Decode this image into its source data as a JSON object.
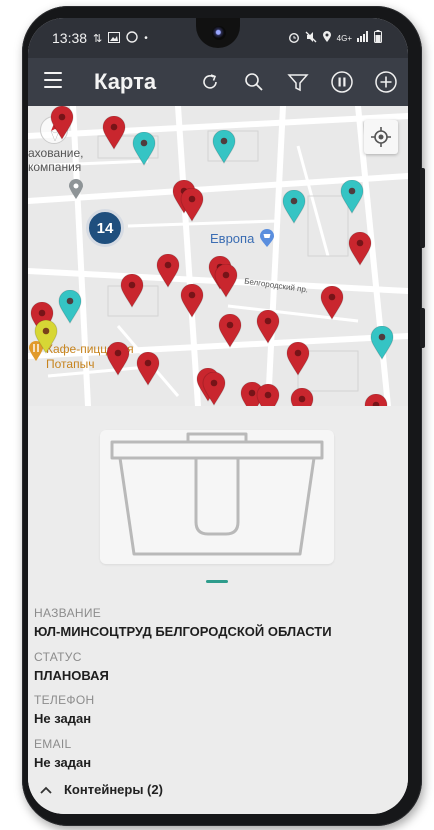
{
  "status_bar": {
    "time": "13:38",
    "left_icons": [
      "data-transfer-icon",
      "image-icon",
      "whatsapp-icon",
      "dot-icon"
    ],
    "right_icons": [
      "alarm-icon",
      "mute-icon",
      "location-icon",
      "signal-icon",
      "battery-icon"
    ],
    "network": "4G+"
  },
  "app_bar": {
    "title": "Карта",
    "actions": [
      "refresh-icon",
      "search-icon",
      "filter-icon",
      "pause-icon",
      "add-icon"
    ]
  },
  "map": {
    "cluster_count": "14",
    "labels": {
      "insurance_line1": "ахование,",
      "insurance_line2": "компания",
      "store": "Европа",
      "street": "Белгородский пр.",
      "cafe_line1": "Кафе-пиццерия",
      "cafe_line2": "Потапыч"
    }
  },
  "details": {
    "name_label": "НАЗВАНИЕ",
    "name_value": "ЮЛ-МИНСОЦТРУД БЕЛГОРОДСКОЙ ОБЛАСТИ",
    "status_label": "СТАТУС",
    "status_value": "ПЛАНОВАЯ",
    "phone_label": "ТЕЛЕФОН",
    "phone_value": "Не задан",
    "email_label": "EMAIL",
    "email_value": "Не задан"
  },
  "containers": {
    "label": "Контейнеры (2)",
    "expander_icon": "chevron-up-icon"
  },
  "colors": {
    "app_bar": "#3a3e47",
    "red_pin": "#c9262e",
    "teal_pin": "#35c4c4",
    "accent": "#2e9c8c",
    "cluster": "#1f4f7e"
  }
}
